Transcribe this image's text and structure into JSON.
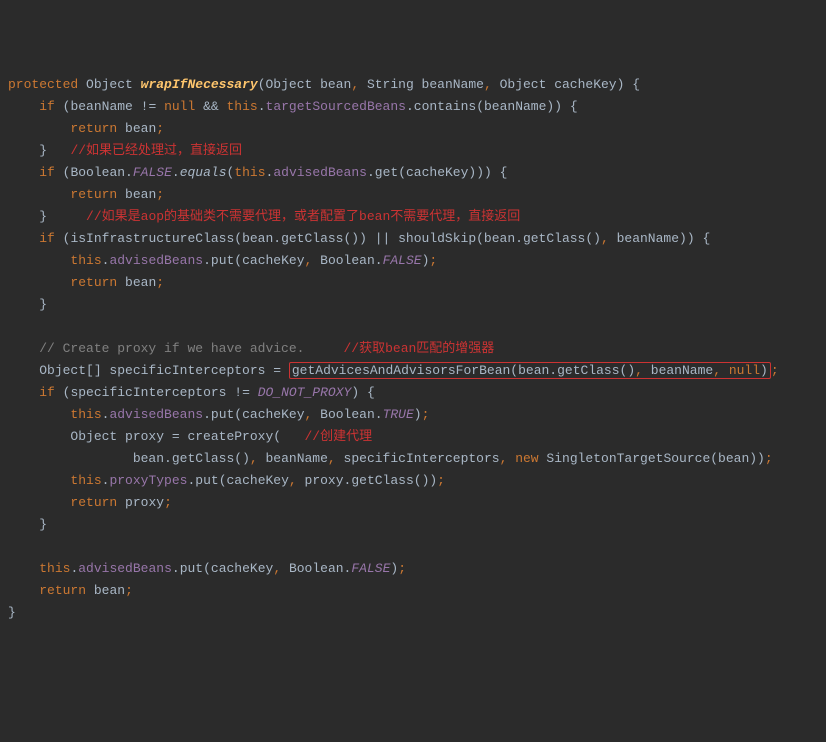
{
  "code": {
    "l1": {
      "kw1": "protected",
      "t1": "Object",
      "m": "wrapIfNecessary",
      "p1": "(Object bean",
      "p2": "String beanName",
      "p3": "Object cacheKey)",
      "b": "{"
    },
    "l2": {
      "kw": "if",
      "c": "(beanName != ",
      "nul": "null",
      " && ": " && ",
      "th": "this",
      "f": "targetSourcedBeans",
      "call": "contains",
      "arg": "(beanName))",
      "b": "{"
    },
    "l3": {
      "kw": "return",
      "v": "bean"
    },
    "l4": {
      "b": "}",
      "c": "//如果已经处理过，直接返回"
    },
    "l5": {
      "kw": "if",
      "t": "(Boolean.",
      "c": "FALSE",
      "eq": "equals",
      "th": "this",
      "f": "advisedBeans",
      "g": "get",
      "a": "(cacheKey)))",
      "b": "{"
    },
    "l6": {
      "kw": "return",
      "v": "bean"
    },
    "l7": {
      "b": "}",
      "c": "//如果是aop的基础类不需要代理，或者配置了bean不需要代理，直接返回"
    },
    "l8": {
      "kw": "if",
      "c1": "(isInfrastructureClass(bean.",
      "g": "getClass",
      "c2": "()) || shouldSkip(bean.",
      "g2": "getClass",
      "c3": "()",
      "bn": "beanName",
      "c4": "))",
      "b": "{"
    },
    "l9": {
      "th": "this",
      "f": "advisedBeans",
      "p": "put",
      "a": "(cacheKey",
      "t": "Boolean.",
      "c": "FALSE",
      "e": ")"
    },
    "l10": {
      "kw": "return",
      "v": "bean"
    },
    "l11": {
      "b": "}"
    },
    "l12": {
      "c": "// Create proxy if we have advice.",
      "r": "//获取bean匹配的增强器"
    },
    "l13": {
      "t": "Object[] specificInterceptors = ",
      "call": "getAdvicesAndAdvisorsForBean",
      "a1": "(bean.",
      "g": "getClass",
      "a2": "()",
      "bn": "beanName",
      "nul": "null",
      "e": ")"
    },
    "l14": {
      "kw": "if",
      "c": "(specificInterceptors != ",
      "d": "DO_NOT_PROXY",
      "e": ")",
      "b": "{"
    },
    "l15": {
      "th": "this",
      "f": "advisedBeans",
      "p": "put",
      "a": "(cacheKey",
      "t": "Boolean.",
      "c": "TRUE",
      "e": ")"
    },
    "l16": {
      "t": "Object proxy = createProxy(",
      "r": "//创建代理"
    },
    "l17": {
      "c1": "bean.",
      "g": "getClass",
      "c2": "()",
      "bn": "beanName",
      "si": "specificInterceptors",
      "nw": "new",
      "sts": "SingletonTargetSource",
      "a": "(bean))"
    },
    "l18": {
      "th": "this",
      "f": "proxyTypes",
      "p": "put",
      "a": "(cacheKey",
      "pr": "proxy.",
      "g": "getClass",
      "e": "())"
    },
    "l19": {
      "kw": "return",
      "v": "proxy"
    },
    "l20": {
      "b": "}"
    },
    "l21": {
      "th": "this",
      "f": "advisedBeans",
      "p": "put",
      "a": "(cacheKey",
      "t": "Boolean.",
      "c": "FALSE",
      "e": ")"
    },
    "l22": {
      "kw": "return",
      "v": "bean"
    },
    "l23": {
      "b": "}"
    }
  }
}
